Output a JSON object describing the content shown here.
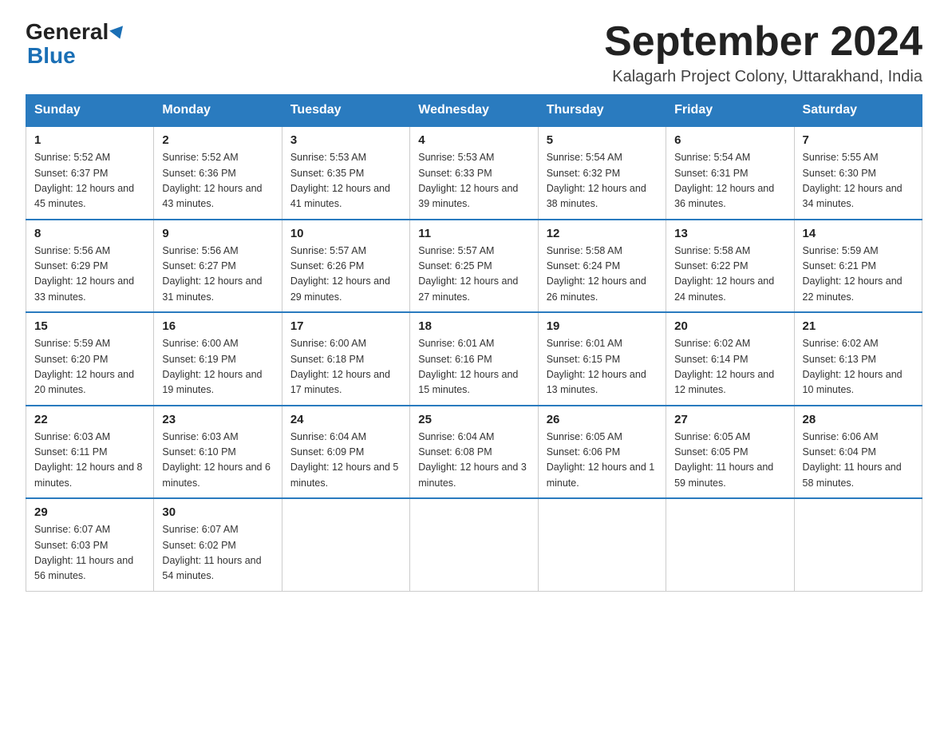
{
  "header": {
    "logo_general": "General",
    "logo_blue": "Blue",
    "month_title": "September 2024",
    "location": "Kalagarh Project Colony, Uttarakhand, India"
  },
  "weekdays": [
    "Sunday",
    "Monday",
    "Tuesday",
    "Wednesday",
    "Thursday",
    "Friday",
    "Saturday"
  ],
  "weeks": [
    [
      {
        "day": "1",
        "sunrise": "Sunrise: 5:52 AM",
        "sunset": "Sunset: 6:37 PM",
        "daylight": "Daylight: 12 hours and 45 minutes."
      },
      {
        "day": "2",
        "sunrise": "Sunrise: 5:52 AM",
        "sunset": "Sunset: 6:36 PM",
        "daylight": "Daylight: 12 hours and 43 minutes."
      },
      {
        "day": "3",
        "sunrise": "Sunrise: 5:53 AM",
        "sunset": "Sunset: 6:35 PM",
        "daylight": "Daylight: 12 hours and 41 minutes."
      },
      {
        "day": "4",
        "sunrise": "Sunrise: 5:53 AM",
        "sunset": "Sunset: 6:33 PM",
        "daylight": "Daylight: 12 hours and 39 minutes."
      },
      {
        "day": "5",
        "sunrise": "Sunrise: 5:54 AM",
        "sunset": "Sunset: 6:32 PM",
        "daylight": "Daylight: 12 hours and 38 minutes."
      },
      {
        "day": "6",
        "sunrise": "Sunrise: 5:54 AM",
        "sunset": "Sunset: 6:31 PM",
        "daylight": "Daylight: 12 hours and 36 minutes."
      },
      {
        "day": "7",
        "sunrise": "Sunrise: 5:55 AM",
        "sunset": "Sunset: 6:30 PM",
        "daylight": "Daylight: 12 hours and 34 minutes."
      }
    ],
    [
      {
        "day": "8",
        "sunrise": "Sunrise: 5:56 AM",
        "sunset": "Sunset: 6:29 PM",
        "daylight": "Daylight: 12 hours and 33 minutes."
      },
      {
        "day": "9",
        "sunrise": "Sunrise: 5:56 AM",
        "sunset": "Sunset: 6:27 PM",
        "daylight": "Daylight: 12 hours and 31 minutes."
      },
      {
        "day": "10",
        "sunrise": "Sunrise: 5:57 AM",
        "sunset": "Sunset: 6:26 PM",
        "daylight": "Daylight: 12 hours and 29 minutes."
      },
      {
        "day": "11",
        "sunrise": "Sunrise: 5:57 AM",
        "sunset": "Sunset: 6:25 PM",
        "daylight": "Daylight: 12 hours and 27 minutes."
      },
      {
        "day": "12",
        "sunrise": "Sunrise: 5:58 AM",
        "sunset": "Sunset: 6:24 PM",
        "daylight": "Daylight: 12 hours and 26 minutes."
      },
      {
        "day": "13",
        "sunrise": "Sunrise: 5:58 AM",
        "sunset": "Sunset: 6:22 PM",
        "daylight": "Daylight: 12 hours and 24 minutes."
      },
      {
        "day": "14",
        "sunrise": "Sunrise: 5:59 AM",
        "sunset": "Sunset: 6:21 PM",
        "daylight": "Daylight: 12 hours and 22 minutes."
      }
    ],
    [
      {
        "day": "15",
        "sunrise": "Sunrise: 5:59 AM",
        "sunset": "Sunset: 6:20 PM",
        "daylight": "Daylight: 12 hours and 20 minutes."
      },
      {
        "day": "16",
        "sunrise": "Sunrise: 6:00 AM",
        "sunset": "Sunset: 6:19 PM",
        "daylight": "Daylight: 12 hours and 19 minutes."
      },
      {
        "day": "17",
        "sunrise": "Sunrise: 6:00 AM",
        "sunset": "Sunset: 6:18 PM",
        "daylight": "Daylight: 12 hours and 17 minutes."
      },
      {
        "day": "18",
        "sunrise": "Sunrise: 6:01 AM",
        "sunset": "Sunset: 6:16 PM",
        "daylight": "Daylight: 12 hours and 15 minutes."
      },
      {
        "day": "19",
        "sunrise": "Sunrise: 6:01 AM",
        "sunset": "Sunset: 6:15 PM",
        "daylight": "Daylight: 12 hours and 13 minutes."
      },
      {
        "day": "20",
        "sunrise": "Sunrise: 6:02 AM",
        "sunset": "Sunset: 6:14 PM",
        "daylight": "Daylight: 12 hours and 12 minutes."
      },
      {
        "day": "21",
        "sunrise": "Sunrise: 6:02 AM",
        "sunset": "Sunset: 6:13 PM",
        "daylight": "Daylight: 12 hours and 10 minutes."
      }
    ],
    [
      {
        "day": "22",
        "sunrise": "Sunrise: 6:03 AM",
        "sunset": "Sunset: 6:11 PM",
        "daylight": "Daylight: 12 hours and 8 minutes."
      },
      {
        "day": "23",
        "sunrise": "Sunrise: 6:03 AM",
        "sunset": "Sunset: 6:10 PM",
        "daylight": "Daylight: 12 hours and 6 minutes."
      },
      {
        "day": "24",
        "sunrise": "Sunrise: 6:04 AM",
        "sunset": "Sunset: 6:09 PM",
        "daylight": "Daylight: 12 hours and 5 minutes."
      },
      {
        "day": "25",
        "sunrise": "Sunrise: 6:04 AM",
        "sunset": "Sunset: 6:08 PM",
        "daylight": "Daylight: 12 hours and 3 minutes."
      },
      {
        "day": "26",
        "sunrise": "Sunrise: 6:05 AM",
        "sunset": "Sunset: 6:06 PM",
        "daylight": "Daylight: 12 hours and 1 minute."
      },
      {
        "day": "27",
        "sunrise": "Sunrise: 6:05 AM",
        "sunset": "Sunset: 6:05 PM",
        "daylight": "Daylight: 11 hours and 59 minutes."
      },
      {
        "day": "28",
        "sunrise": "Sunrise: 6:06 AM",
        "sunset": "Sunset: 6:04 PM",
        "daylight": "Daylight: 11 hours and 58 minutes."
      }
    ],
    [
      {
        "day": "29",
        "sunrise": "Sunrise: 6:07 AM",
        "sunset": "Sunset: 6:03 PM",
        "daylight": "Daylight: 11 hours and 56 minutes."
      },
      {
        "day": "30",
        "sunrise": "Sunrise: 6:07 AM",
        "sunset": "Sunset: 6:02 PM",
        "daylight": "Daylight: 11 hours and 54 minutes."
      },
      null,
      null,
      null,
      null,
      null
    ]
  ]
}
